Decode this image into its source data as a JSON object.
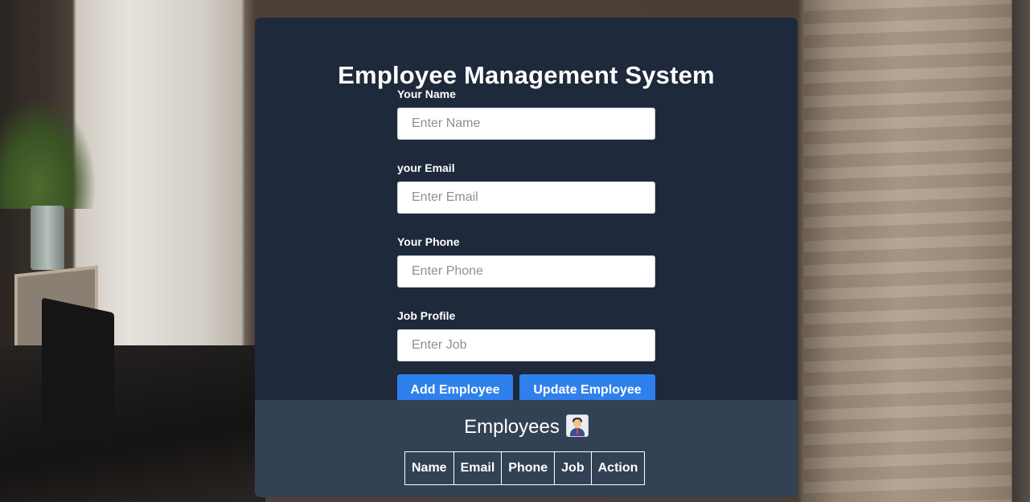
{
  "form": {
    "title": "Employee Management System",
    "fields": [
      {
        "label": "Your Name",
        "placeholder": "Enter Name",
        "value": ""
      },
      {
        "label": "your Email",
        "placeholder": "Enter Email",
        "value": ""
      },
      {
        "label": "Your Phone",
        "placeholder": "Enter Phone",
        "value": ""
      },
      {
        "label": "Job Profile",
        "placeholder": "Enter Job",
        "value": ""
      }
    ],
    "add_label": "Add Employee",
    "update_label": "Update Employee"
  },
  "employees": {
    "heading": "Employees",
    "heading_icon": "man-office-worker-icon",
    "columns": [
      "Name",
      "Email",
      "Phone",
      "Job",
      "Action"
    ],
    "rows": []
  },
  "colors": {
    "card_background": "#1e293b",
    "list_background": "#334155",
    "button_accent": "#2f80ed",
    "text": "#ffffff"
  }
}
